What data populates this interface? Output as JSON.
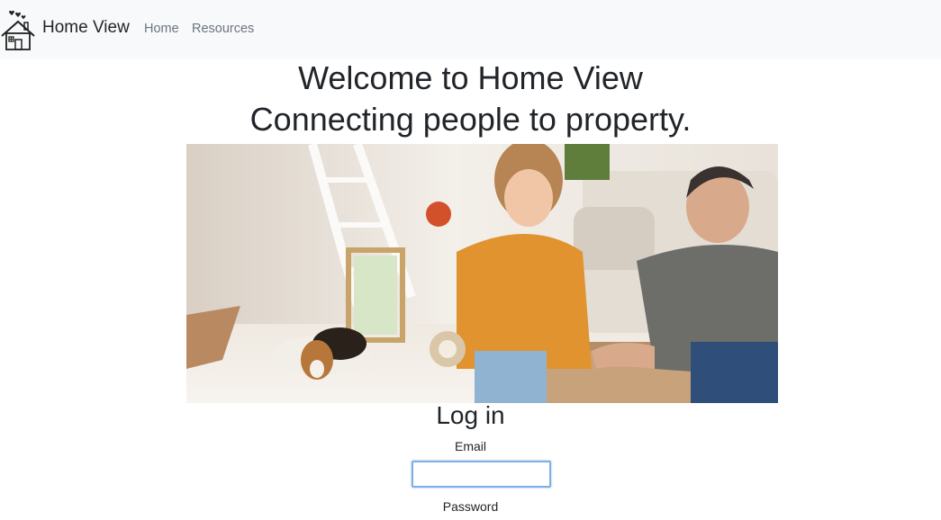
{
  "navbar": {
    "brand": "Home View",
    "brand_icon": "house-hearts-icon",
    "links": [
      "Home",
      "Resources"
    ]
  },
  "main": {
    "headline": "Welcome to Home View",
    "subheadline": "Connecting people to property.",
    "hero_image": "couple-packing-boxes-photo"
  },
  "login": {
    "title": "Log in",
    "email_label": "Email",
    "email_value": "",
    "password_label": "Password"
  },
  "colors": {
    "navbar_bg": "#f8f9fa",
    "nav_link": "#6c757d",
    "text": "#212529",
    "input_focus_border": "#7fb0e0"
  }
}
